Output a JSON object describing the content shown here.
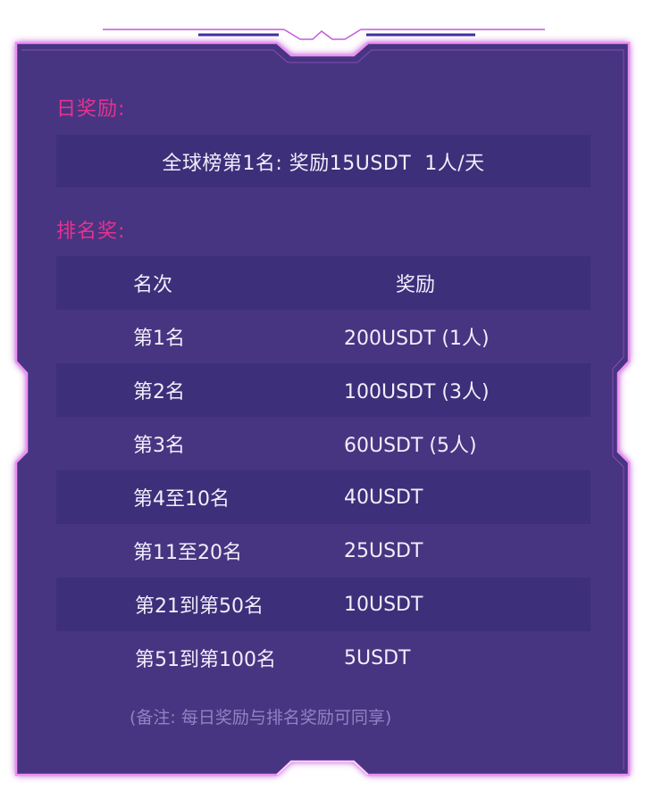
{
  "daily": {
    "title": "日奖励:",
    "text": "全球榜第1名: 奖励15USDT  1人/天"
  },
  "ranking": {
    "title": "排名奖:",
    "header": {
      "place": "名次",
      "reward": "奖励"
    },
    "rows": [
      {
        "place": "第1名",
        "reward": "200USDT (1人)"
      },
      {
        "place": "第2名",
        "reward": "100USDT (3人)"
      },
      {
        "place": "第3名",
        "reward": "60USDT (5人)"
      },
      {
        "place": "第4至10名",
        "reward": "40USDT"
      },
      {
        "place": "第11至20名",
        "reward": "25USDT"
      },
      {
        "place": "第21到第50名",
        "reward": "10USDT"
      },
      {
        "place": "第51到第100名",
        "reward": "5USDT"
      }
    ]
  },
  "note": "(备注: 每日奖励与排名奖励可同享)",
  "colors": {
    "panel": "#463681",
    "row_shade": "#3d2f79",
    "accent": "#e8318f",
    "neon": "#e070f0",
    "text": "#f1eefb",
    "note": "#8f83c3"
  }
}
